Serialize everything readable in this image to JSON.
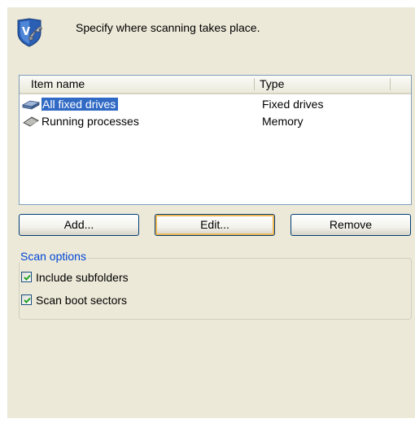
{
  "header": {
    "icon": "shield-wrench-icon",
    "description": "Specify where scanning takes place."
  },
  "list": {
    "columns": [
      "Item name",
      "Type"
    ],
    "rows": [
      {
        "name": "All fixed drives",
        "type": "Fixed drives",
        "icon": "hard-drive-icon",
        "selected": true
      },
      {
        "name": "Running processes",
        "type": "Memory",
        "icon": "memory-chip-icon",
        "selected": false
      }
    ]
  },
  "buttons": {
    "add": "Add...",
    "edit": "Edit...",
    "remove": "Remove"
  },
  "scan_options": {
    "title": "Scan options",
    "include_subfolders": {
      "label": "Include subfolders",
      "checked": true
    },
    "scan_boot_sectors": {
      "label": "Scan boot sectors",
      "checked": true
    }
  },
  "colors": {
    "panel_background": "#ece9d8",
    "selection": "#316ac5",
    "group_title": "#0046d5",
    "default_button_focus": "#f0b753",
    "checkmark": "#21a121"
  }
}
